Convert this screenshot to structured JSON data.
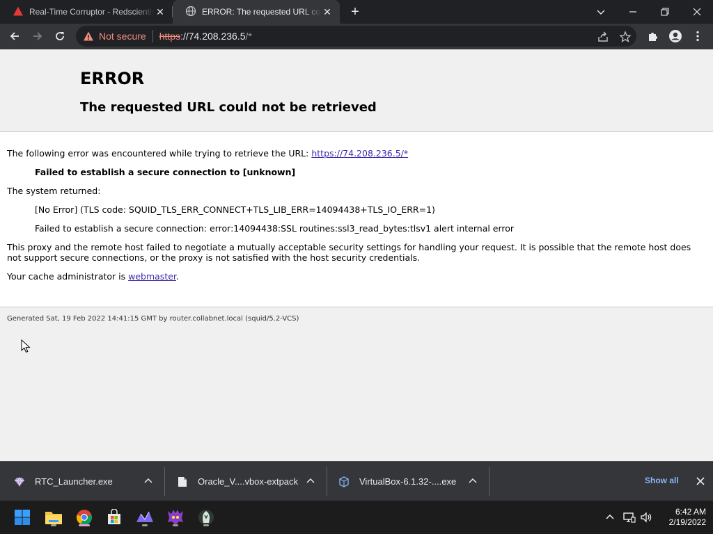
{
  "browser": {
    "tabs": [
      {
        "title": "Real-Time Corruptor - Redscientist",
        "active": false
      },
      {
        "title": "ERROR: The requested URL could not be retrieved",
        "active": true
      }
    ],
    "omnibox": {
      "security_label": "Not secure",
      "scheme": "https",
      "host": "://74.208.236.5",
      "path": "/*"
    }
  },
  "page": {
    "heading": "ERROR",
    "subheading": "The requested URL could not be retrieved",
    "intro": "The following error was encountered while trying to retrieve the URL:",
    "url_link": "https://74.208.236.5/*",
    "failure": "Failed to establish a secure connection to [unknown]",
    "system_returned_label": "The system returned:",
    "error_code": "[No Error] (TLS code: SQUID_TLS_ERR_CONNECT+TLS_LIB_ERR=14094438+TLS_IO_ERR=1)",
    "error_detail": "Failed to establish a secure connection: error:14094438:SSL routines:ssl3_read_bytes:tlsv1 alert internal error",
    "explanation": "This proxy and the remote host failed to negotiate a mutually acceptable security settings for handling your request. It is possible that the remote host does not support secure connections, or the proxy is not satisfied with the host security credentials.",
    "admin_prefix": "Your cache administrator is ",
    "admin_link": "webmaster",
    "admin_suffix": ".",
    "footer": "Generated Sat, 19 Feb 2022 14:41:15 GMT by router.collabnet.local (squid/5.2-VCS)"
  },
  "downloads": {
    "items": [
      {
        "name": "RTC_Launcher.exe",
        "icon": "gem-icon"
      },
      {
        "name": "Oracle_V....vbox-extpack",
        "icon": "file-icon"
      },
      {
        "name": "VirtualBox-6.1.32-....exe",
        "icon": "package-icon"
      }
    ],
    "show_all": "Show all"
  },
  "taskbar": {
    "apps": [
      "start-icon",
      "file-explorer-icon",
      "chrome-icon",
      "store-icon",
      "app-icon",
      "game-icon",
      "app-icon"
    ],
    "time": "6:42 AM",
    "date": "2/19/2022"
  },
  "colors": {
    "accent_link": "#8ab4f8",
    "warning": "#f28b82"
  }
}
